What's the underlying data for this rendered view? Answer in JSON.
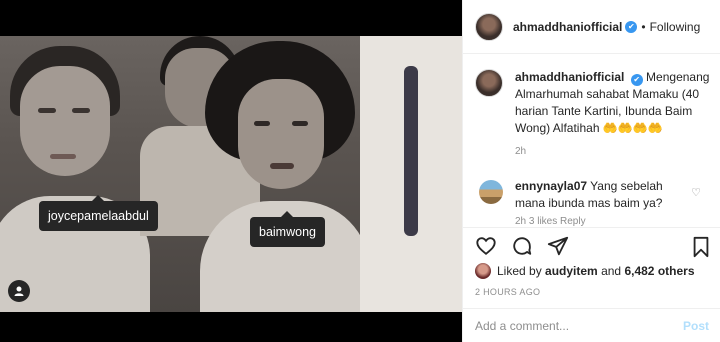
{
  "post": {
    "author": "ahmaddhaniofficial",
    "verified_mark": "✔",
    "separator": "•",
    "follow_status": "Following",
    "caption_author": "ahmaddhaniofficial",
    "caption_text": "Mengenang Almarhumah sahabat Mamaku (40 harian Tante Kartini, Ibunda Baim Wong) Alfatihah 🤲🤲🤲🤲",
    "caption_age": "2h"
  },
  "photo": {
    "tags": [
      "joycepamelaabdul",
      "baimwong"
    ]
  },
  "comment": {
    "author": "ennynayla07",
    "text": "Yang sebelah mana ibunda mas baim ya?",
    "meta": "2h   3 likes   Reply"
  },
  "likes": {
    "prefix": "Liked by",
    "user": "audyitem",
    "joiner": "and",
    "others": "6,482 others"
  },
  "timestamp": "2 HOURS AGO",
  "composer": {
    "placeholder": "Add a comment...",
    "post_label": "Post"
  },
  "icons": {
    "like": "heart-icon",
    "comment": "comment-bubble-icon",
    "share": "paper-plane-icon",
    "save": "bookmark-icon",
    "user_tags": "person-icon"
  },
  "colors": {
    "verified": "#3897f0",
    "muted": "#8e8e8e",
    "post_button": "#b2dffc"
  }
}
